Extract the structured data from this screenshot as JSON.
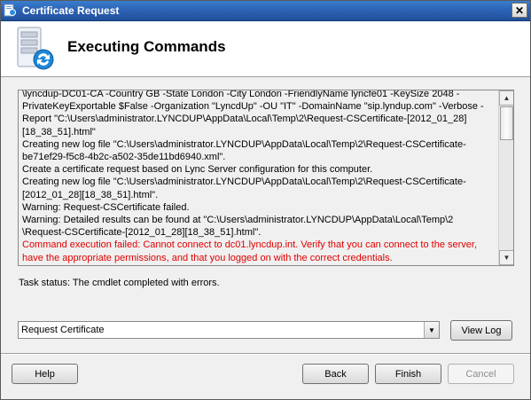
{
  "window": {
    "title": "Certificate Request",
    "close_glyph": "✕"
  },
  "header": {
    "title": "Executing Commands",
    "icon": "server-sync-icon"
  },
  "log": {
    "lines": [
      {
        "text": "\\lyncdup-DC01-CA  -Country GB -State  London  -City  London  -FriendlyName  lyncfe01  -KeySize 2048 -",
        "error": false
      },
      {
        "text": "PrivateKeyExportable $False -Organization \"LyncdUp\" -OU \"IT\" -DomainName \"sip.lyndup.com\" -Verbose -",
        "error": false
      },
      {
        "text": "Report \"C:\\Users\\administrator.LYNCDUP\\AppData\\Local\\Temp\\2\\Request-CSCertificate-[2012_01_28]",
        "error": false
      },
      {
        "text": "[18_38_51].html\"",
        "error": false
      },
      {
        "text": "Creating new log file \"C:\\Users\\administrator.LYNCDUP\\AppData\\Local\\Temp\\2\\Request-CSCertificate-",
        "error": false
      },
      {
        "text": "be71ef29-f5c8-4b2c-a502-35de11bd6940.xml\".",
        "error": false
      },
      {
        "text": "Create a certificate request based on Lync Server configuration for this computer.",
        "error": false
      },
      {
        "text": "Creating new log file \"C:\\Users\\administrator.LYNCDUP\\AppData\\Local\\Temp\\2\\Request-CSCertificate-",
        "error": false
      },
      {
        "text": "[2012_01_28][18_38_51].html\".",
        "error": false
      },
      {
        "text": "Warning: Request-CSCertificate failed.",
        "error": false
      },
      {
        "text": "Warning: Detailed results can be found at \"C:\\Users\\administrator.LYNCDUP\\AppData\\Local\\Temp\\2",
        "error": false
      },
      {
        "text": "\\Request-CSCertificate-[2012_01_28][18_38_51].html\".",
        "error": false
      },
      {
        "text": "Command execution failed: Cannot connect to dc01.lyncdup.int. Verify that you can connect to the server,",
        "error": true
      },
      {
        "text": "have the appropriate permissions, and that you logged on with the correct credentials.",
        "error": true
      }
    ],
    "error_color": "#e00000"
  },
  "status": {
    "text": "Task status: The cmdlet completed with errors."
  },
  "command_select": {
    "value": "Request Certificate"
  },
  "buttons": {
    "view_log": "View Log",
    "help": "Help",
    "back": "Back",
    "finish": "Finish",
    "cancel": "Cancel"
  }
}
